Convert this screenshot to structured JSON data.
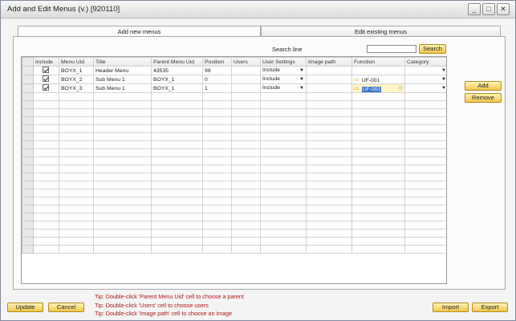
{
  "window": {
    "title": "Add and Edit Menus (v.) [920110]",
    "minimize_glyph": "_",
    "maximize_glyph": "□",
    "close_glyph": "✕"
  },
  "tabs": [
    {
      "label": "Add new menus",
      "active": true
    },
    {
      "label": "Edit existing menus",
      "active": false
    }
  ],
  "search": {
    "label": "Search line",
    "value": "",
    "button": "Search"
  },
  "grid": {
    "columns": [
      "Include",
      "Menu Uid",
      "Title",
      "Parent Menu Uid",
      "Position",
      "Users",
      "User Settings",
      "Image path",
      "Function",
      "Category"
    ],
    "rows": [
      {
        "include": true,
        "menu_uid": "BOYX_1",
        "title": "Header Menu",
        "parent": "43535",
        "position": "99",
        "users": "",
        "user_settings": "Include",
        "image_path": "",
        "function": "",
        "category": ""
      },
      {
        "include": true,
        "menu_uid": "BOYX_2",
        "title": "Sub Menu 1",
        "parent": "BOYX_1",
        "position": "0",
        "users": "",
        "user_settings": "Include",
        "image_path": "",
        "function": "UF-001",
        "category": ""
      },
      {
        "include": true,
        "menu_uid": "BOYX_3",
        "title": "Sub Menu 1",
        "parent": "BOYX_1",
        "position": "1",
        "users": "",
        "user_settings": "Include",
        "image_path": "",
        "function": "UF-002",
        "category": ""
      }
    ],
    "empty_rows": 20
  },
  "side_buttons": {
    "add": "Add",
    "remove": "Remove"
  },
  "bottom_buttons": {
    "update": "Update",
    "cancel": "Cancel",
    "import": "Import",
    "export": "Export"
  },
  "tips": [
    "Tip: Double-click 'Parent Menu Uid' cell to choose a parent",
    "Tip: Double-click 'Users' cell to choose users",
    "Tip: Double-click 'Image path' cell to choose an image"
  ],
  "icons": {
    "dropdown": "triangle-down-icon",
    "link_arrow": "link-arrow-icon",
    "checkbox": "checkmark-icon"
  },
  "colors": {
    "accent_button": "#f0c84b",
    "tip_text": "#b01818",
    "selection": "#3a74cc"
  }
}
